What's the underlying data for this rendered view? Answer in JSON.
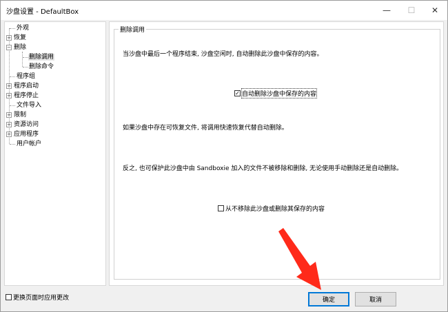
{
  "window": {
    "title": "沙盘设置 - DefaultBox",
    "controls": {
      "minimize": "—",
      "maximize": "☐",
      "close": "✕"
    }
  },
  "tree": {
    "items": [
      {
        "label": "外观",
        "expander": ""
      },
      {
        "label": "恢复",
        "expander": "+"
      },
      {
        "label": "删除",
        "expander": "−"
      },
      {
        "label": "删除调用",
        "expander": ""
      },
      {
        "label": "删除命令",
        "expander": ""
      },
      {
        "label": "程序组",
        "expander": ""
      },
      {
        "label": "程序启动",
        "expander": "+"
      },
      {
        "label": "程序停止",
        "expander": "+"
      },
      {
        "label": "文件导入",
        "expander": ""
      },
      {
        "label": "限制",
        "expander": "+"
      },
      {
        "label": "资源访问",
        "expander": "+"
      },
      {
        "label": "应用程序",
        "expander": "+"
      },
      {
        "label": "用户帐户",
        "expander": ""
      }
    ]
  },
  "panel": {
    "group_title": "删除调用",
    "desc1": "当沙盘中最后一个程序结束, 沙盘空闲时, 自动删除此沙盘中保存的内容。",
    "check1": {
      "label": "自动删除沙盘中保存的内容",
      "checked": true,
      "mark": "✓"
    },
    "desc2": "如果沙盘中存在可恢复文件, 将调用快速恢复代替自动删除。",
    "desc3": "反之, 也可保护此沙盘中由 Sandboxie 加入的文件不被移除和删除, 无论使用手动删除还是自动删除。",
    "check2": {
      "label": "从不移除此沙盘或删除其保存的内容",
      "checked": false,
      "mark": ""
    }
  },
  "footer": {
    "apply_on_change": {
      "label": "更换页面时应用更改",
      "checked": false,
      "mark": ""
    },
    "ok": "确定",
    "cancel": "取消"
  },
  "colors": {
    "accent": "#0078d7",
    "annotation_arrow": "#ff2a1a"
  }
}
